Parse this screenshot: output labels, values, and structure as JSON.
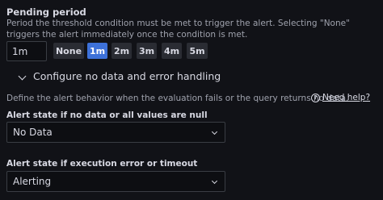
{
  "pending": {
    "title": "Pending period",
    "description": "Period the threshold condition must be met to trigger the alert. Selecting \"None\" triggers the alert immediately once the condition is met.",
    "value": "1m",
    "options": [
      "None",
      "1m",
      "2m",
      "3m",
      "4m",
      "5m"
    ],
    "selected": "1m"
  },
  "no_data_section": {
    "title": "Configure no data and error handling",
    "description": "Define the alert behavior when the evaluation fails or the query returns no data.",
    "help_label": "Need help?",
    "help_icon": "help-circle-icon"
  },
  "no_data_state": {
    "label": "Alert state if no data or all values are null",
    "value": "No Data"
  },
  "error_state": {
    "label": "Alert state if execution error or timeout",
    "value": "Alerting"
  },
  "colors": {
    "background": "#111217",
    "active_option": "#3d71d9",
    "option": "#2a2c33"
  }
}
